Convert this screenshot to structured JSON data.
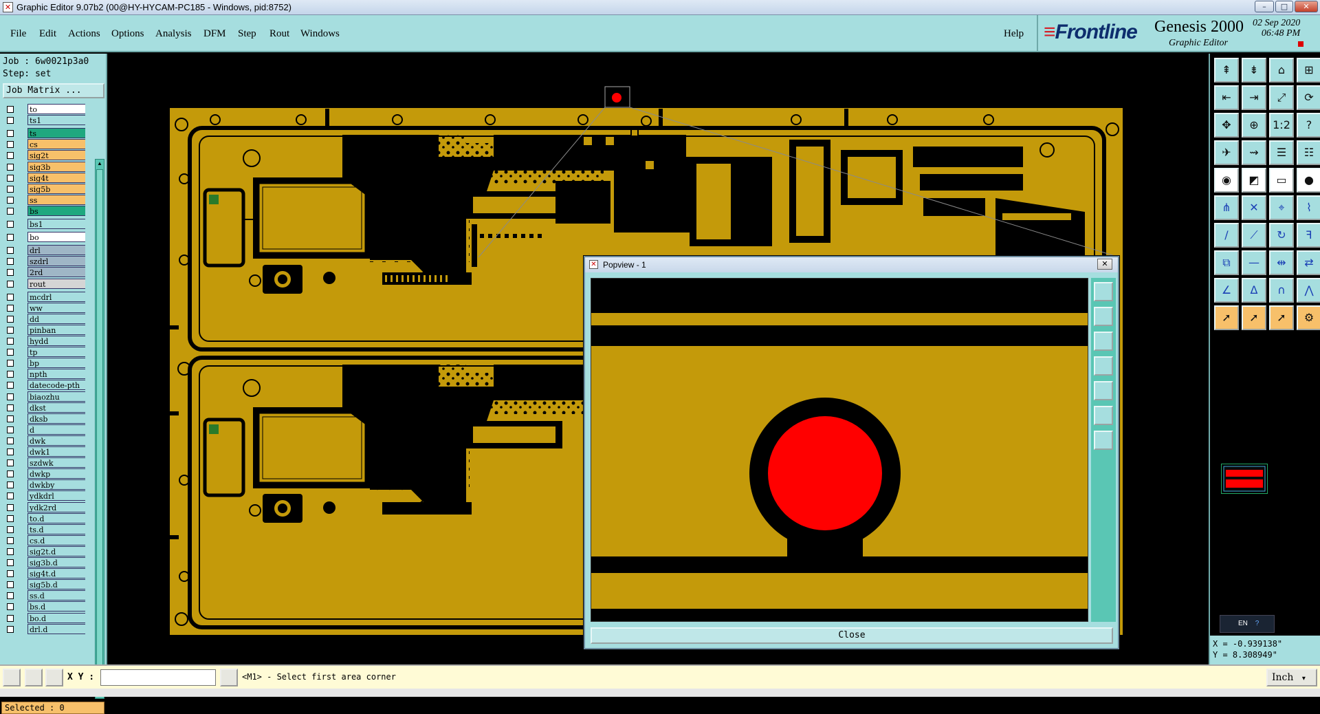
{
  "window": {
    "title": "Graphic Editor 9.07b2 (00@HY-HYCAM-PC185 - Windows, pid:8752)",
    "minimize": "–",
    "maximize": "□",
    "close": "✕"
  },
  "menubar": {
    "items": [
      "File",
      "Edit",
      "Actions",
      "Options",
      "Analysis",
      "DFM",
      "Step",
      "Rout",
      "Windows"
    ],
    "help": "Help"
  },
  "brand": {
    "logo_main": "Frontline",
    "product": "Genesis 2000",
    "subtitle": "Graphic Editor",
    "date": "02 Sep 2020",
    "time": "06:48 PM"
  },
  "leftpanel": {
    "job": "Job : 6w0021p3a0",
    "step": "Step: set",
    "job_matrix_label": "Job Matrix ...",
    "selected": "Selected : 0"
  },
  "layers": [
    {
      "name": "to",
      "color": "#ffffff"
    },
    {
      "name": "ts1",
      "color": "#a6dedf"
    },
    {
      "name": "ts",
      "color": "#1fa87f"
    },
    {
      "name": "cs",
      "color": "#f7c06a"
    },
    {
      "name": "sig2t",
      "color": "#f7c06a"
    },
    {
      "name": "sig3b",
      "color": "#f7c06a"
    },
    {
      "name": "sig4t",
      "color": "#f7c06a"
    },
    {
      "name": "sig5b",
      "color": "#f7c06a"
    },
    {
      "name": "ss",
      "color": "#f7c06a"
    },
    {
      "name": "bs",
      "color": "#1fa87f"
    },
    {
      "name": "bs1",
      "color": "#a6dedf"
    },
    {
      "name": "bo",
      "color": "#ffffff"
    },
    {
      "name": "drl",
      "color": "#9fb6c6"
    },
    {
      "name": "szdrl",
      "color": "#9fb6c6"
    },
    {
      "name": "2rd",
      "color": "#9fb6c6"
    },
    {
      "name": "rout",
      "color": "#d5d5d5"
    },
    {
      "name": "mcdrl",
      "color": "#a6dedf"
    },
    {
      "name": "ww",
      "color": "#a6dedf"
    },
    {
      "name": "dd",
      "color": "#a6dedf"
    },
    {
      "name": "pinban",
      "color": "#a6dedf"
    },
    {
      "name": "hydd",
      "color": "#a6dedf"
    },
    {
      "name": "tp",
      "color": "#a6dedf"
    },
    {
      "name": "bp",
      "color": "#a6dedf"
    },
    {
      "name": "npth",
      "color": "#a6dedf"
    },
    {
      "name": "datecode-pth",
      "color": "#a6dedf"
    },
    {
      "name": "biaozhu",
      "color": "#a6dedf"
    },
    {
      "name": "dkst",
      "color": "#a6dedf"
    },
    {
      "name": "dksb",
      "color": "#a6dedf"
    },
    {
      "name": "d",
      "color": "#a6dedf"
    },
    {
      "name": "dwk",
      "color": "#a6dedf"
    },
    {
      "name": "dwk1",
      "color": "#a6dedf"
    },
    {
      "name": "szdwk",
      "color": "#a6dedf"
    },
    {
      "name": "dwkp",
      "color": "#a6dedf"
    },
    {
      "name": "dwkby",
      "color": "#a6dedf"
    },
    {
      "name": "ydkdrl",
      "color": "#a6dedf"
    },
    {
      "name": "ydk2rd",
      "color": "#a6dedf"
    },
    {
      "name": "to.d",
      "color": "#a6dedf"
    },
    {
      "name": "ts.d",
      "color": "#a6dedf"
    },
    {
      "name": "cs.d",
      "color": "#a6dedf"
    },
    {
      "name": "sig2t.d",
      "color": "#a6dedf"
    },
    {
      "name": "sig3b.d",
      "color": "#a6dedf"
    },
    {
      "name": "sig4t.d",
      "color": "#a6dedf"
    },
    {
      "name": "sig5b.d",
      "color": "#a6dedf"
    },
    {
      "name": "ss.d",
      "color": "#a6dedf"
    },
    {
      "name": "bs.d",
      "color": "#a6dedf"
    },
    {
      "name": "bo.d",
      "color": "#a6dedf"
    },
    {
      "name": "drl.d",
      "color": "#a6dedf"
    }
  ],
  "colors": {
    "board": "#c49a0a",
    "copper_dark": "#000000",
    "highlight": "#ff0000",
    "panel": "#a6dedf"
  },
  "toolbar_icons": [
    "snap-top-icon",
    "snap-bottom-icon",
    "home-view-icon",
    "window-split-icon",
    "pan-left-icon",
    "pan-right-icon",
    "zoom-fit-icon",
    "redraw-icon",
    "zoom-in-icon",
    "zoom-out-icon",
    "scale-1-2-icon",
    "query-icon",
    "helicopter-icon",
    "route-icon",
    "layer-stack-icon",
    "layer-filter-icon",
    "add-pad-icon",
    "draw-rect-icon",
    "measure-icon",
    "record-icon",
    "connect-icon",
    "delete-icon",
    "snap-node-icon",
    "break-icon",
    "line-icon",
    "slash-icon",
    "arc-icon",
    "text-icon",
    "copy-feature-icon",
    "move-icon",
    "align-icon",
    "replace-icon",
    "angle-icon",
    "triangle-icon",
    "arch-icon",
    "polygon-icon",
    "select-arrow-icon",
    "select-highlight-icon",
    "select-outline-icon",
    "select-route-icon"
  ],
  "rightpanel": {
    "lang": "EN",
    "x": "X = -0.939138\"",
    "y": "Y = 8.308949\""
  },
  "status": {
    "xy_label": "X Y :",
    "xy_value": "",
    "message": "<M1> - Select first area corner",
    "unit": "Inch"
  },
  "popview": {
    "title": "Popview - 1",
    "close_label": "Close",
    "close_x": "✕"
  }
}
